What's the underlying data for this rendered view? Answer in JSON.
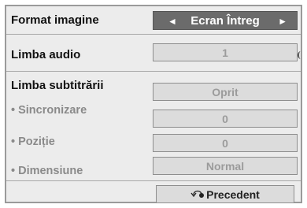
{
  "menu": {
    "format": {
      "label": "Format imagine",
      "value": "Ecran Întreg",
      "left_arrow": "◄",
      "right_arrow": "►"
    },
    "audio": {
      "label": "Limba audio",
      "value": "1"
    },
    "subtitle": {
      "label": "Limba subtitrării",
      "value": "Oprit"
    },
    "sync": {
      "label": "• Sincronizare",
      "value": "0"
    },
    "position": {
      "label": "• Poziție",
      "value": "0"
    },
    "size": {
      "label": "• Dimensiune",
      "value": "Normal"
    }
  },
  "footer": {
    "back_label": "Precedent",
    "back_icon": "return-arrow-icon"
  },
  "colors": {
    "highlight": "#6b6b6b",
    "panel": "#ececec",
    "disabled_text": "#9b9b9b"
  }
}
